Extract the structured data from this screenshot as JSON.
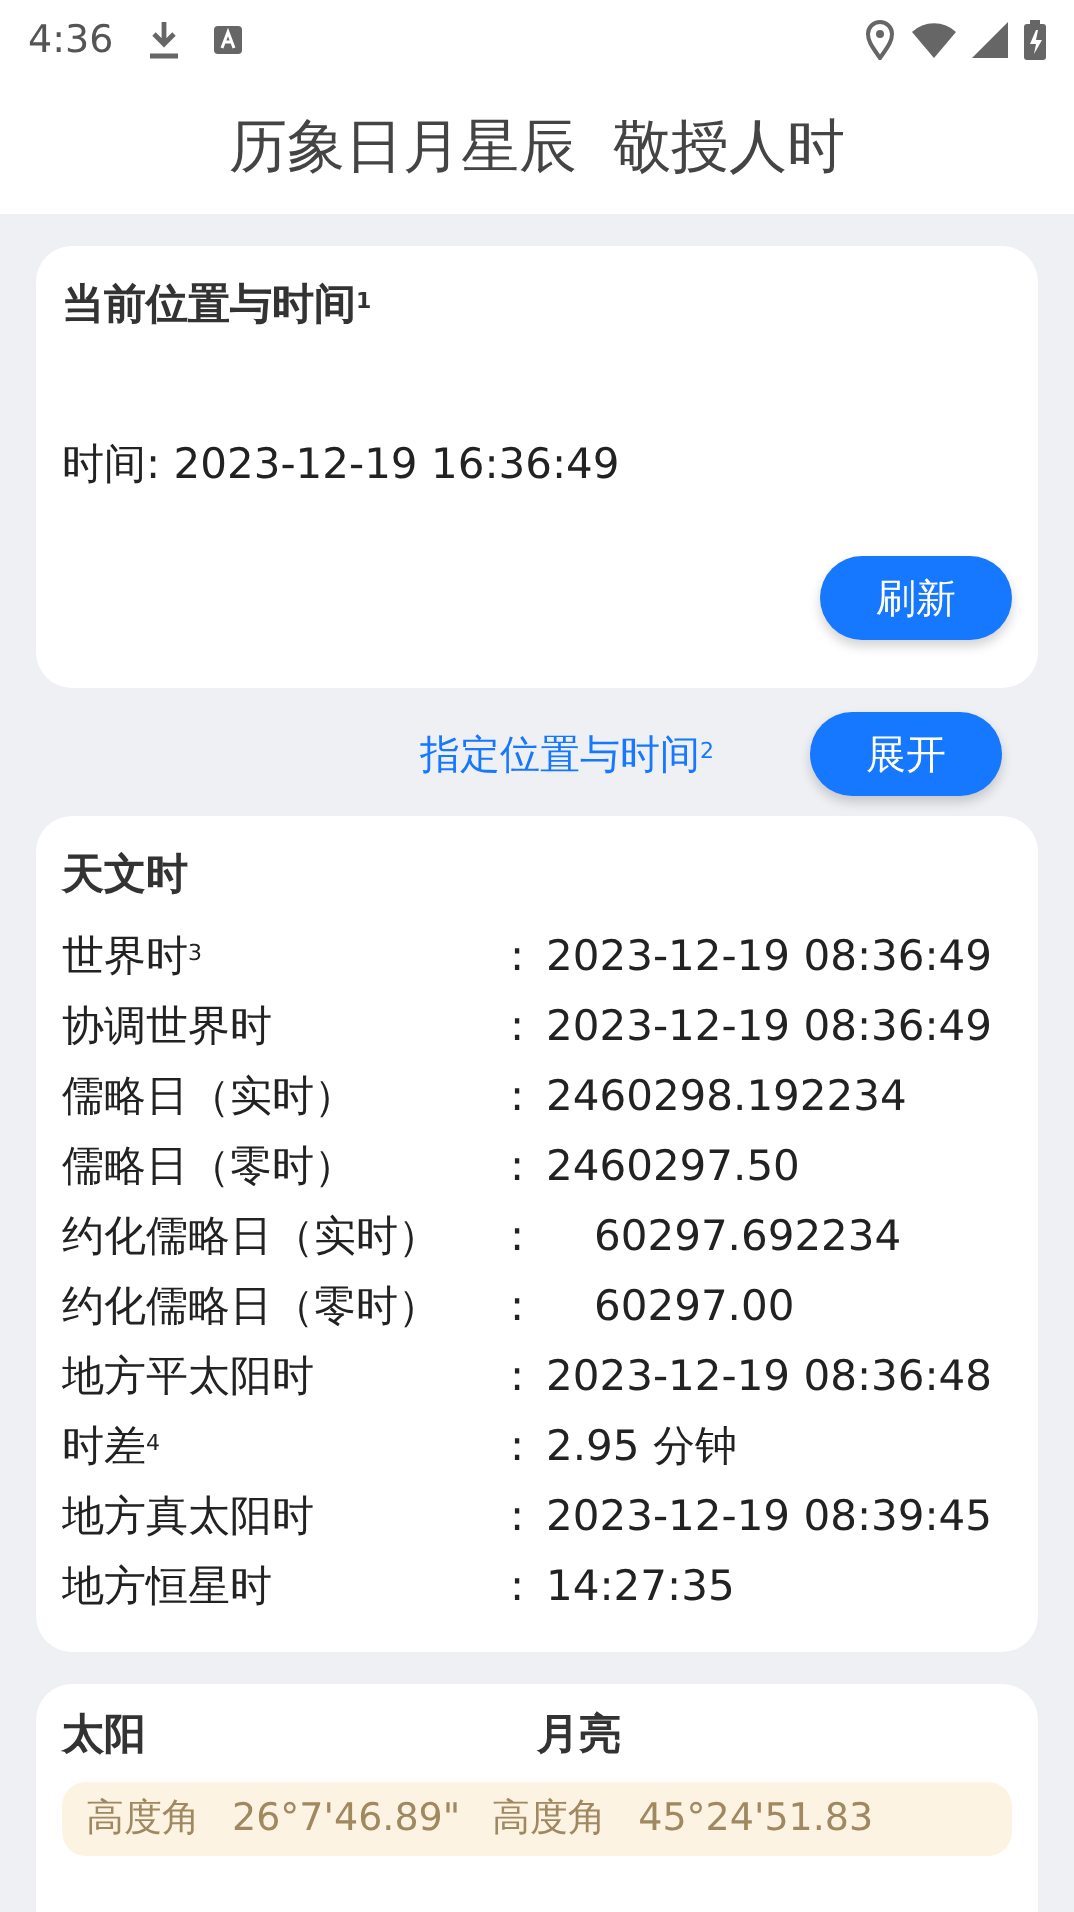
{
  "status_bar": {
    "time": "4:36"
  },
  "app_title": "历象日月星辰  敬授人时",
  "current": {
    "title": "当前位置与时间$^{1}$",
    "time_line": "时间: 2023-12-19 16:36:49",
    "button": "刷新"
  },
  "specify": {
    "link": "指定位置与时间$^{2}$",
    "button": "展开"
  },
  "astro": {
    "title": "天文时",
    "rows": [
      {
        "label": "世界时$^{3}$",
        "sep": ":",
        "value": "2023-12-19 08:36:49",
        "indent": false
      },
      {
        "label": "协调世界时",
        "sep": ":",
        "value": "2023-12-19 08:36:49",
        "indent": false
      },
      {
        "label": "儒略日（实时）",
        "sep": ":",
        "value": "2460298.192234",
        "indent": false
      },
      {
        "label": "儒略日（零时）",
        "sep": ":",
        "value": "2460297.50",
        "indent": false
      },
      {
        "label": "约化儒略日（实时）",
        "sep": ":",
        "value": "60297.692234",
        "indent": true
      },
      {
        "label": "约化儒略日（零时）",
        "sep": ":",
        "value": "60297.00",
        "indent": true
      },
      {
        "label": "地方平太阳时",
        "sep": ":",
        "value": "2023-12-19 08:36:48",
        "indent": false
      },
      {
        "label": "时差$^{4}$",
        "sep": ":",
        "value": "2.95 分钟",
        "indent": false
      },
      {
        "label": "地方真太阳时",
        "sep": ":",
        "value": "2023-12-19 08:39:45",
        "indent": false
      },
      {
        "label": "地方恒星时",
        "sep": ":",
        "value": "14:27:35",
        "indent": false
      }
    ]
  },
  "sun_moon": {
    "headers": [
      "太阳",
      "月亮"
    ],
    "rows": [
      {
        "cells": [
          "高度角",
          "26°7'46.89\"",
          "高度角",
          "45°24'51.83"
        ]
      }
    ]
  }
}
